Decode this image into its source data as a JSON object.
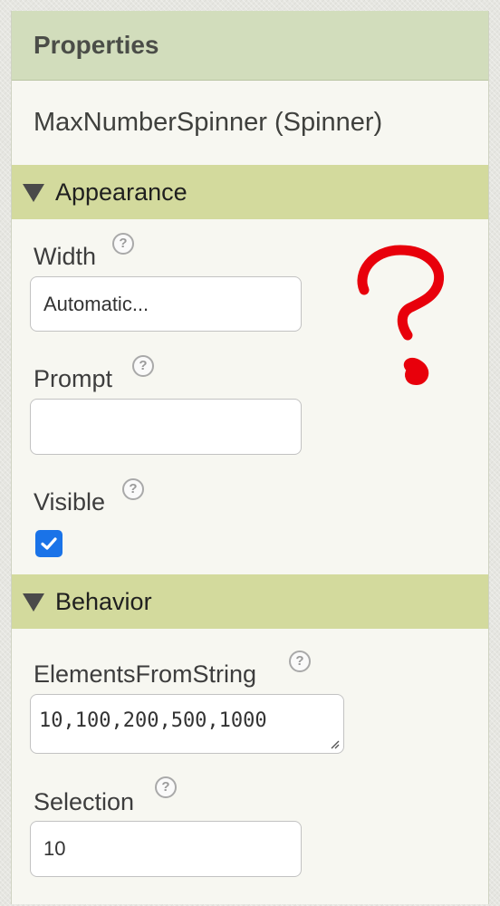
{
  "panel": {
    "title": "Properties",
    "component_name": "MaxNumberSpinner (Spinner)"
  },
  "appearance": {
    "title": "Appearance",
    "width": {
      "label": "Width",
      "value": "Automatic..."
    },
    "prompt": {
      "label": "Prompt",
      "value": ""
    },
    "visible": {
      "label": "Visible",
      "checked": true
    }
  },
  "behavior": {
    "title": "Behavior",
    "elements_from_string": {
      "label": "ElementsFromString",
      "value": "10,100,200,500,1000"
    },
    "selection": {
      "label": "Selection",
      "value": "10"
    }
  },
  "help_glyph": "?",
  "colors": {
    "header_bg": "#d2ddbc",
    "section_bg": "#d3da9d",
    "panel_bg": "#f7f7f1",
    "checkbox": "#1a73e8",
    "annotation": "#e8000b"
  },
  "icons": [
    "triangle-down-icon",
    "help-icon",
    "checkmark-icon",
    "resize-grip-icon",
    "question-mark-annotation-icon"
  ]
}
